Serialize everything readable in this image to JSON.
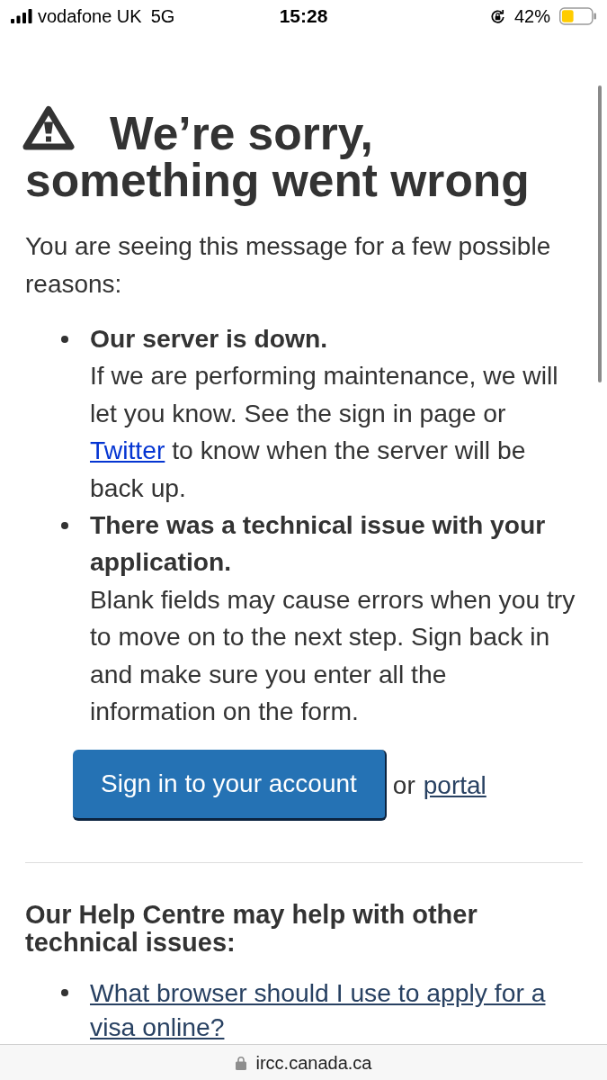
{
  "status_bar": {
    "carrier": "vodafone UK",
    "network": "5G",
    "time": "15:28",
    "battery_percent": "42%"
  },
  "heading_lines": [
    "We’re sorry,",
    "something went wrong"
  ],
  "intro": "You are seeing this message for a few possible reasons:",
  "reasons": [
    {
      "title": "Our server is down.",
      "body": [
        {
          "kind": "text",
          "text": "If we are performing maintenance, we will let you know. See the sign in page or "
        },
        {
          "kind": "link",
          "text": "Twitter"
        },
        {
          "kind": "text",
          "text": " to know when the server will be back up."
        }
      ]
    },
    {
      "title": "There was a technical issue with your application.",
      "body": [
        {
          "kind": "text",
          "text": "Blank fields may cause errors when you try to move on to the next step. Sign back in and make sure you enter all the information on the form."
        }
      ]
    }
  ],
  "sign_in": {
    "button": "Sign in to your account",
    "separator": "or",
    "link": "portal"
  },
  "help": {
    "heading": "Our Help Centre may help with other technical issues:",
    "links": [
      "What browser should I use to apply for a visa online?"
    ]
  },
  "address_bar": {
    "url": "ircc.canada.ca"
  }
}
